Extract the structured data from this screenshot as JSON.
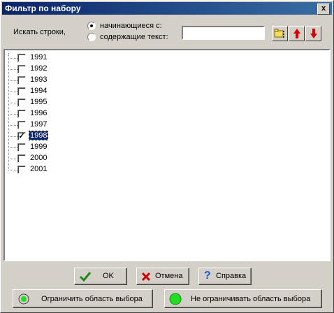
{
  "window": {
    "title": "Фильтр по набору",
    "close": "x"
  },
  "search": {
    "label": "Искать строки,",
    "opt_starts": "начинающиеся с:",
    "opt_contains": "содержащие текст:",
    "selected": "starts",
    "value": ""
  },
  "toolbar": {
    "icons": [
      "find-icon",
      "arrow-up-icon",
      "arrow-down-icon"
    ],
    "colors": {
      "arrow": "#d40000",
      "find": "#f0e060"
    }
  },
  "items": [
    {
      "label": "1991",
      "checked": false
    },
    {
      "label": "1992",
      "checked": false
    },
    {
      "label": "1993",
      "checked": false
    },
    {
      "label": "1994",
      "checked": false
    },
    {
      "label": "1995",
      "checked": false
    },
    {
      "label": "1996",
      "checked": false
    },
    {
      "label": "1997",
      "checked": false
    },
    {
      "label": "1998",
      "checked": true,
      "selected": true
    },
    {
      "label": "1999",
      "checked": false
    },
    {
      "label": "2000",
      "checked": false
    },
    {
      "label": "2001",
      "checked": false
    }
  ],
  "buttons": {
    "ok": "OK",
    "cancel": "Отмена",
    "help": "Справка",
    "limit": "Ограничить область выбора",
    "nolimit": "Не ограничивать область выбора"
  },
  "colors": {
    "titlebar": "#0a246a",
    "ok_check": "#1a8a1a",
    "cancel_x": "#cc0000",
    "help_q": "#1060d0",
    "circle": "#22dd22"
  }
}
